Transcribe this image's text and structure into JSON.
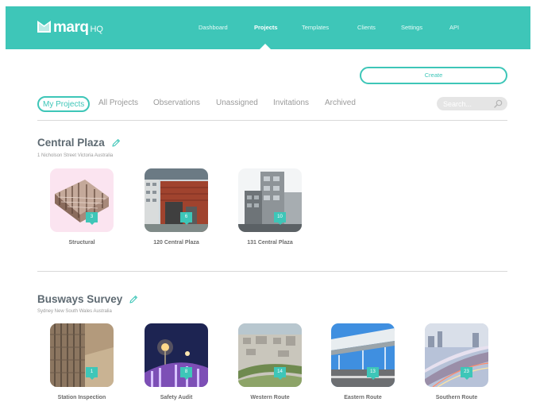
{
  "app": {
    "brand": "marq",
    "brand_suffix": "HQ",
    "accent_color": "#3ec6b8"
  },
  "nav": {
    "items": [
      {
        "label": "Dashboard",
        "active": false
      },
      {
        "label": "Projects",
        "active": true
      },
      {
        "label": "Templates",
        "active": false
      },
      {
        "label": "Clients",
        "active": false
      },
      {
        "label": "Settings",
        "active": false
      },
      {
        "label": "API",
        "active": false
      }
    ]
  },
  "toolbar": {
    "create_label": "Create",
    "search_placeholder": "Search...",
    "filters": [
      {
        "label": "My Projects",
        "active": true
      },
      {
        "label": "All Projects",
        "active": false
      },
      {
        "label": "Observations",
        "active": false
      },
      {
        "label": "Unassigned",
        "active": false
      },
      {
        "label": "Invitations",
        "active": false
      },
      {
        "label": "Archived",
        "active": false
      }
    ]
  },
  "sections": [
    {
      "title": "Central Plaza",
      "address": "1 Nicholson Street Victoria Australia",
      "folders": [
        {
          "name": "Structural",
          "count": "3"
        },
        {
          "name": "120 Central Plaza",
          "count": "6"
        },
        {
          "name": "131 Central Plaza",
          "count": "10"
        }
      ]
    },
    {
      "title": "Busways Survey",
      "address": "Sydney New South Wales Australia",
      "folders": [
        {
          "name": "Station Inspection",
          "count": "1"
        },
        {
          "name": "Safety Audit",
          "count": "8"
        },
        {
          "name": "Western Route",
          "count": "14"
        },
        {
          "name": "Eastern Route",
          "count": "13"
        },
        {
          "name": "Southern Route",
          "count": "23"
        }
      ]
    }
  ]
}
